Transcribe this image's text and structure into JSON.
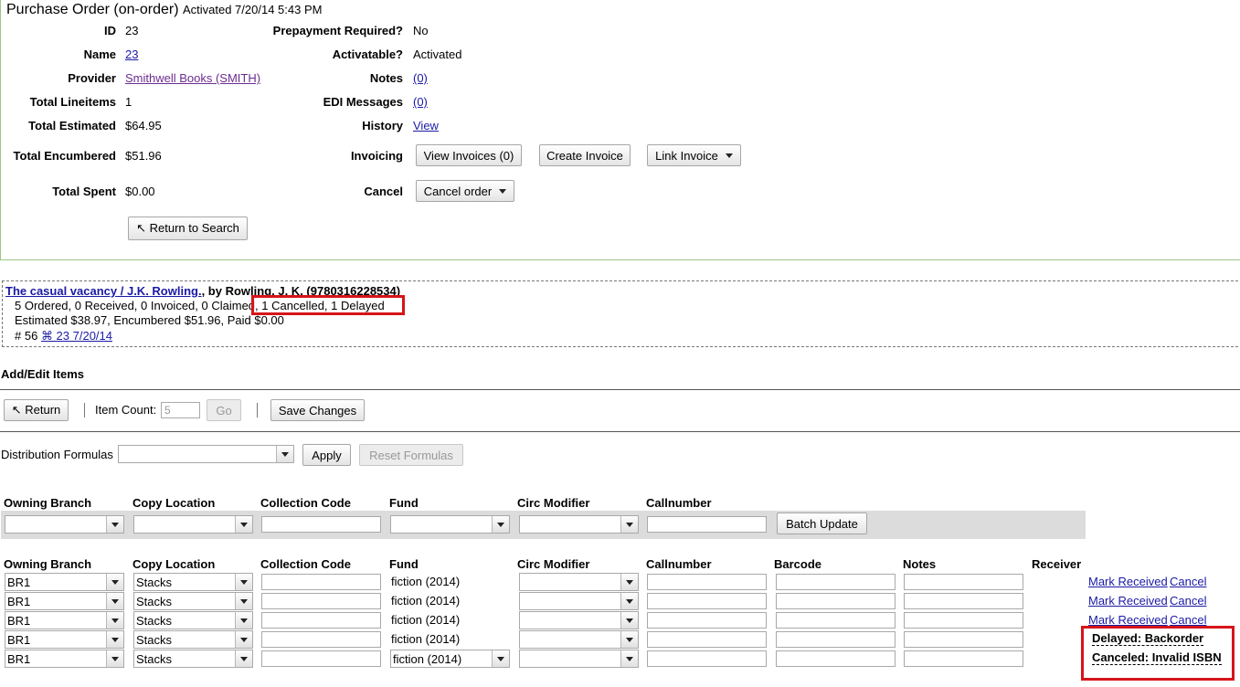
{
  "po": {
    "title": "Purchase Order (on-order)",
    "activated": "Activated 7/20/14 5:43 PM",
    "id_label": "ID",
    "id": "23",
    "name_label": "Name",
    "name": "23",
    "provider_label": "Provider",
    "provider": "Smithwell Books (SMITH)",
    "lineitems_label": "Total Lineitems",
    "lineitems": "1",
    "estimated_label": "Total Estimated",
    "estimated": "$64.95",
    "encumbered_label": "Total Encumbered",
    "encumbered": "$51.96",
    "spent_label": "Total Spent",
    "spent": "$0.00",
    "prepay_label": "Prepayment Required?",
    "prepay": "No",
    "activatable_label": "Activatable?",
    "activatable": "Activated",
    "notes_label": "Notes",
    "notes": "(0)",
    "edi_label": "EDI Messages",
    "edi": "(0)",
    "history_label": "History",
    "history": "View",
    "invoicing_label": "Invoicing",
    "view_invoices": "View Invoices (0)",
    "create_invoice": "Create Invoice",
    "link_invoice": "Link Invoice",
    "cancel_label": "Cancel",
    "cancel_order": "Cancel order",
    "return_to_search": "↖ Return to Search"
  },
  "lineitem": {
    "title": "The casual vacancy / J.K. Rowling.",
    "author": ", by Rowling, J. K. (9780316228534)",
    "counts": "5 Ordered, 0 Received, 0 Invoiced, 0 Claimed,",
    "cancel_delay": "1 Cancelled, 1 Delayed",
    "money": "Estimated $38.97, Encumbered $51.96, Paid $0.00",
    "num": "# 56",
    "po_link": "⌘ 23 7/20/14"
  },
  "items": {
    "heading": "Add/Edit Items",
    "return": "↖ Return",
    "item_count_label": "Item Count:",
    "item_count_value": "5",
    "go": "Go",
    "save_changes": "Save Changes",
    "distrib_label": "Distribution Formulas",
    "apply": "Apply",
    "reset_formulas": "Reset Formulas",
    "batch_update": "Batch Update"
  },
  "columns": {
    "owning_branch": "Owning Branch",
    "copy_location": "Copy Location",
    "collection_code": "Collection Code",
    "fund": "Fund",
    "circ_modifier": "Circ Modifier",
    "callnumber": "Callnumber",
    "barcode": "Barcode",
    "notes": "Notes",
    "receiver": "Receiver"
  },
  "copies": [
    {
      "branch": "BR1",
      "location": "Stacks",
      "fund": "fiction (2014)",
      "action1": "Mark Received",
      "action2": "Cancel"
    },
    {
      "branch": "BR1",
      "location": "Stacks",
      "fund": "fiction (2014)",
      "action1": "Mark Received",
      "action2": "Cancel"
    },
    {
      "branch": "BR1",
      "location": "Stacks",
      "fund": "fiction (2014)",
      "action1": "Mark Received",
      "action2": "Cancel"
    },
    {
      "branch": "BR1",
      "location": "Stacks",
      "fund": "fiction (2014)",
      "status": "Delayed: Backorder"
    },
    {
      "branch": "BR1",
      "location": "Stacks",
      "fund": "fiction (2014)",
      "status": "Canceled: Invalid ISBN"
    }
  ],
  "colors": {
    "link": "#1a1aa6",
    "highlight": "#d7141b",
    "po_border": "#9fc48a",
    "batch_bar": "#dcdcdc"
  }
}
